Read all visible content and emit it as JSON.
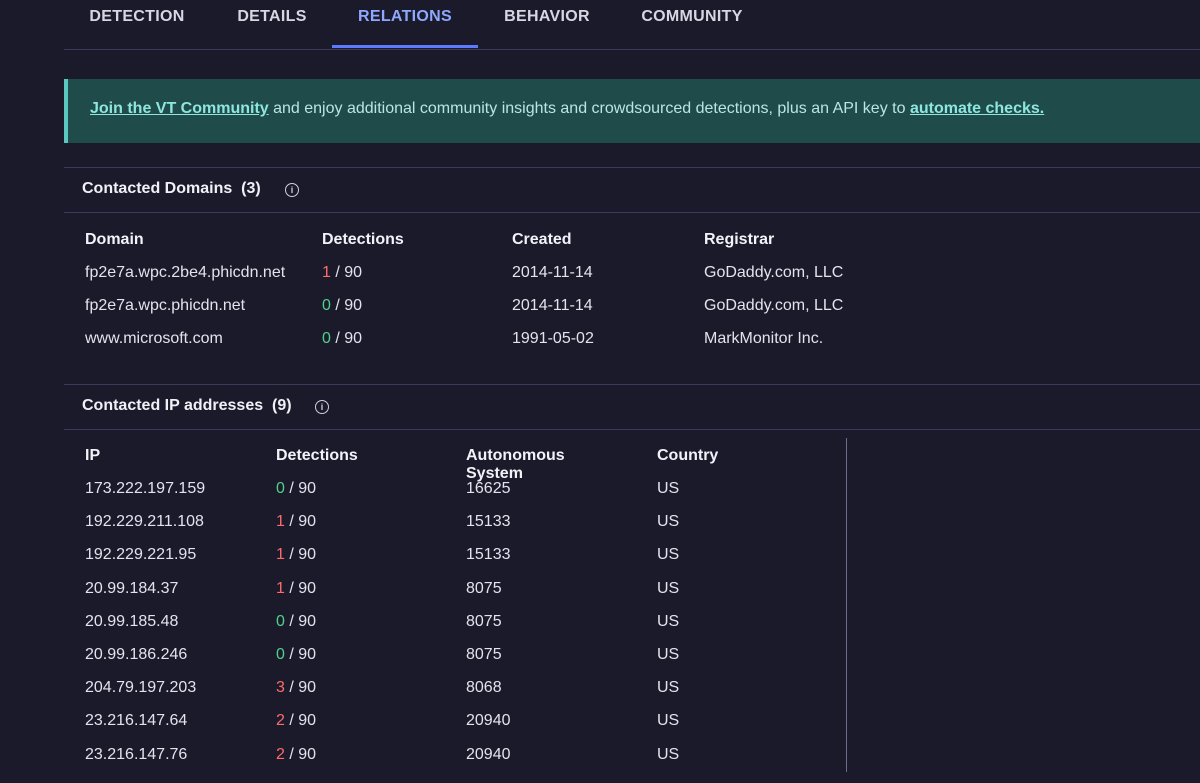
{
  "tabs": [
    {
      "label": "DETECTION",
      "active": false
    },
    {
      "label": "DETAILS",
      "active": false
    },
    {
      "label": "RELATIONS",
      "active": true
    },
    {
      "label": "BEHAVIOR",
      "active": false
    },
    {
      "label": "COMMUNITY",
      "active": false
    }
  ],
  "banner": {
    "link1": "Join the VT Community",
    "middle": " and enjoy additional community insights and crowdsourced detections, plus an API key to ",
    "link2": "automate checks."
  },
  "domains_section": {
    "title": "Contacted Domains",
    "count": "(3)",
    "headers": {
      "domain": "Domain",
      "detections": "Detections",
      "created": "Created",
      "registrar": "Registrar"
    },
    "rows": [
      {
        "domain": "fp2e7a.wpc.2be4.phicdn.net",
        "det": "1",
        "total": " / 90",
        "status": "red",
        "created": "2014-11-14",
        "registrar": "GoDaddy.com, LLC"
      },
      {
        "domain": "fp2e7a.wpc.phicdn.net",
        "det": "0",
        "total": " / 90",
        "status": "green",
        "created": "2014-11-14",
        "registrar": "GoDaddy.com, LLC"
      },
      {
        "domain": "www.microsoft.com",
        "det": "0",
        "total": " / 90",
        "status": "green",
        "created": "1991-05-02",
        "registrar": "MarkMonitor Inc."
      }
    ]
  },
  "ips_section": {
    "title": "Contacted IP addresses",
    "count": "(9)",
    "headers": {
      "ip": "IP",
      "detections": "Detections",
      "as": "Autonomous System",
      "country": "Country"
    },
    "rows": [
      {
        "ip": "173.222.197.159",
        "det": "0",
        "total": " / 90",
        "status": "green",
        "as": "16625",
        "country": "US"
      },
      {
        "ip": "192.229.211.108",
        "det": "1",
        "total": " / 90",
        "status": "red",
        "as": "15133",
        "country": "US"
      },
      {
        "ip": "192.229.221.95",
        "det": "1",
        "total": " / 90",
        "status": "red",
        "as": "15133",
        "country": "US"
      },
      {
        "ip": "20.99.184.37",
        "det": "1",
        "total": " / 90",
        "status": "red",
        "as": "8075",
        "country": "US"
      },
      {
        "ip": "20.99.185.48",
        "det": "0",
        "total": " / 90",
        "status": "green",
        "as": "8075",
        "country": "US"
      },
      {
        "ip": "20.99.186.246",
        "det": "0",
        "total": " / 90",
        "status": "green",
        "as": "8075",
        "country": "US"
      },
      {
        "ip": "204.79.197.203",
        "det": "3",
        "total": " / 90",
        "status": "red",
        "as": "8068",
        "country": "US"
      },
      {
        "ip": "23.216.147.64",
        "det": "2",
        "total": " / 90",
        "status": "red",
        "as": "20940",
        "country": "US"
      },
      {
        "ip": "23.216.147.76",
        "det": "2",
        "total": " / 90",
        "status": "red",
        "as": "20940",
        "country": "US"
      }
    ]
  },
  "colors": {
    "background": "#1b1a2b",
    "accent": "#5b7bff",
    "banner_bg": "#1f4c4b",
    "detection_positive": "#ff6b6b",
    "detection_clean": "#4fd18a"
  },
  "icons": {
    "info": "info-circle-icon"
  }
}
